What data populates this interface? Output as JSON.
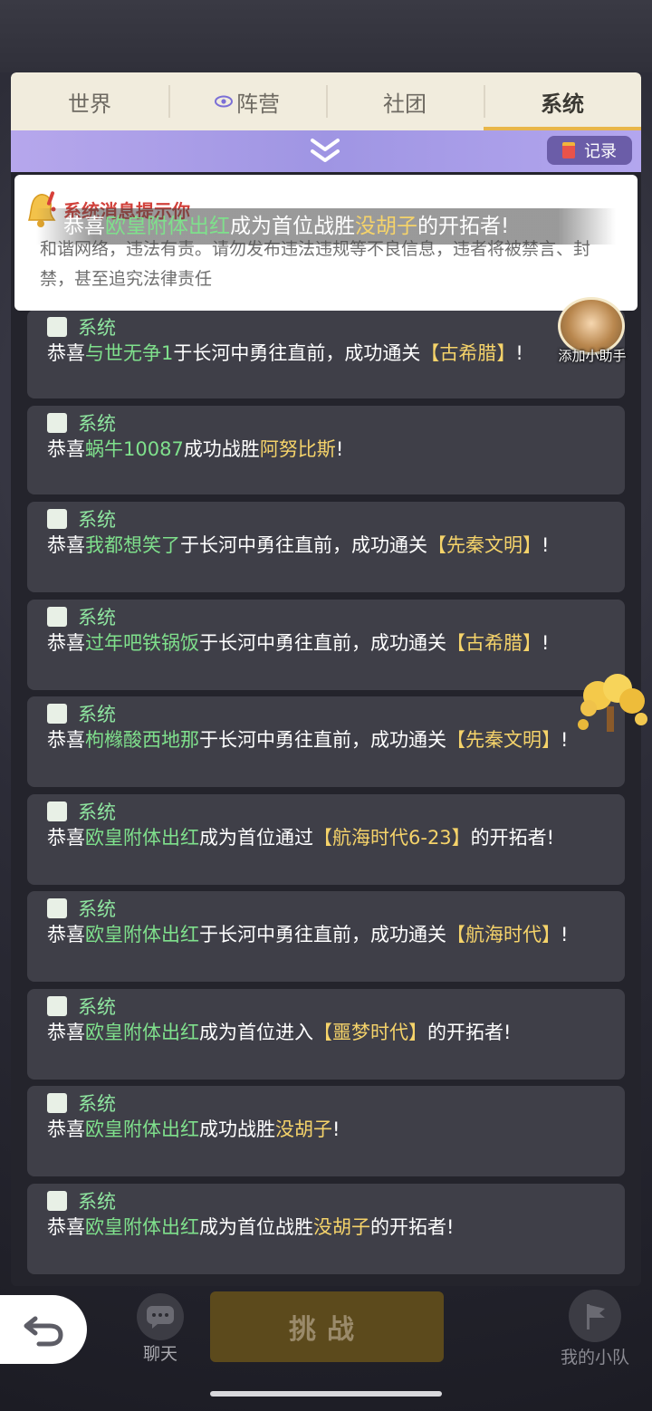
{
  "tabs": [
    {
      "label": "世界",
      "active": false
    },
    {
      "label": "阵营",
      "active": false,
      "icon": "eye-icon"
    },
    {
      "label": "社团",
      "active": false
    },
    {
      "label": "系统",
      "active": true
    }
  ],
  "subbar": {
    "collapse_icon": "double-chevron-down-icon",
    "record_label": "记录"
  },
  "notice": {
    "title": "系统消息提示你",
    "body": "和谐网络，违法有责。请勿发布违法违规等不良信息，违者将被禁言、封禁，甚至追究法律责任"
  },
  "marquee": {
    "prefix": "恭喜",
    "player": "欧皇附体出红",
    "middle": "成为首位战胜",
    "target": "没胡子",
    "suffix": "的开拓者!"
  },
  "helper": {
    "label": "添加小助手"
  },
  "messages": [
    {
      "sender": "系统",
      "prefix": "恭喜",
      "player": "与世无争1",
      "middle": "于长河中勇往直前，成功通关",
      "target": "【古希腊】",
      "suffix": "!"
    },
    {
      "sender": "系统",
      "prefix": "恭喜",
      "player": "蜗牛10087",
      "middle": "成功战胜",
      "target": "阿努比斯",
      "suffix": "!"
    },
    {
      "sender": "系统",
      "prefix": "恭喜",
      "player": "我都想笑了",
      "middle": "于长河中勇往直前，成功通关",
      "target": "【先秦文明】",
      "suffix": "!"
    },
    {
      "sender": "系统",
      "prefix": "恭喜",
      "player": "过年吧铁锅饭",
      "middle": "于长河中勇往直前，成功通关",
      "target": "【古希腊】",
      "suffix": "!"
    },
    {
      "sender": "系统",
      "prefix": "恭喜",
      "player": "枸橼酸西地那",
      "middle": "于长河中勇往直前，成功通关",
      "target": "【先秦文明】",
      "suffix": "!"
    },
    {
      "sender": "系统",
      "prefix": "恭喜",
      "player": "欧皇附体出红",
      "middle": "成为首位通过",
      "target": "【航海时代6-23】",
      "suffix": "的开拓者!"
    },
    {
      "sender": "系统",
      "prefix": "恭喜",
      "player": "欧皇附体出红",
      "middle": "于长河中勇往直前，成功通关",
      "target": "【航海时代】",
      "suffix": "!"
    },
    {
      "sender": "系统",
      "prefix": "恭喜",
      "player": "欧皇附体出红",
      "middle": "成为首位进入",
      "target": "【噩梦时代】",
      "suffix": "的开拓者!"
    },
    {
      "sender": "系统",
      "prefix": "恭喜",
      "player": "欧皇附体出红",
      "middle": "成功战胜",
      "target": "没胡子",
      "suffix": "!"
    },
    {
      "sender": "系统",
      "prefix": "恭喜",
      "player": "欧皇附体出红",
      "middle": "成为首位战胜",
      "target": "没胡子",
      "suffix": "的开拓者!"
    }
  ],
  "bottom": {
    "back_icon": "back-arrow-icon",
    "chat_label": "聊天",
    "challenge_label": "挑战",
    "team_label": "我的小队"
  },
  "colors": {
    "player_name": "#7fe08c",
    "target_name": "#f5d36a",
    "notice_title": "#d1413b",
    "active_tab_underline": "#e8b64a"
  }
}
